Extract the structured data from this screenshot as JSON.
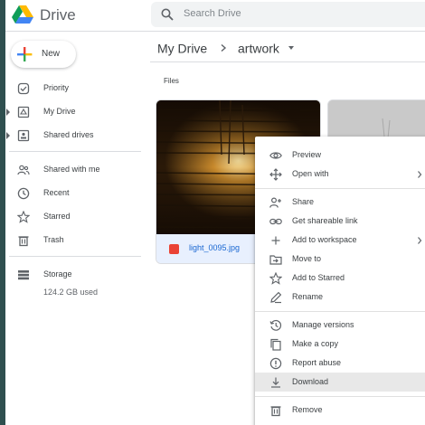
{
  "app": {
    "name": "Drive",
    "search_placeholder": "Search Drive"
  },
  "sidebar": {
    "new_label": "New",
    "items": [
      {
        "label": "Priority",
        "icon": "check-circle-icon"
      },
      {
        "label": "My Drive",
        "icon": "drive-icon"
      },
      {
        "label": "Shared drives",
        "icon": "shared-drives-icon"
      },
      {
        "label": "Shared with me",
        "icon": "people-icon"
      },
      {
        "label": "Recent",
        "icon": "clock-icon"
      },
      {
        "label": "Starred",
        "icon": "star-icon"
      },
      {
        "label": "Trash",
        "icon": "trash-icon"
      },
      {
        "label": "Storage",
        "icon": "storage-icon"
      }
    ],
    "storage_used": "124.2 GB used"
  },
  "main": {
    "breadcrumb_root": "My Drive",
    "breadcrumb_current": "artwork",
    "section_label": "Files",
    "files": [
      {
        "name": "light_0095.jpg",
        "icon": "image-icon"
      }
    ]
  },
  "context_menu": {
    "items": [
      {
        "label": "Preview",
        "icon": "eye-icon"
      },
      {
        "label": "Open with",
        "icon": "move-arrows-icon"
      },
      {
        "label": "Share",
        "icon": "add-person-icon"
      },
      {
        "label": "Get shareable link",
        "icon": "link-icon"
      },
      {
        "label": "Add to workspace",
        "icon": "plus-icon"
      },
      {
        "label": "Move to",
        "icon": "move-folder-icon"
      },
      {
        "label": "Add to Starred",
        "icon": "star-icon"
      },
      {
        "label": "Rename",
        "icon": "pencil-icon"
      },
      {
        "label": "Manage versions",
        "icon": "history-icon"
      },
      {
        "label": "Make a copy",
        "icon": "copy-icon"
      },
      {
        "label": "Report abuse",
        "icon": "alert-icon"
      },
      {
        "label": "Download",
        "icon": "download-icon"
      },
      {
        "label": "Remove",
        "icon": "trash-icon"
      }
    ],
    "highlighted": "Download"
  },
  "colors": {
    "page_bg": "#2f4f4f",
    "accent_blue": "#1967d2",
    "selection_bg": "#e8f0fe",
    "menu_hover": "#e8e8e8"
  }
}
